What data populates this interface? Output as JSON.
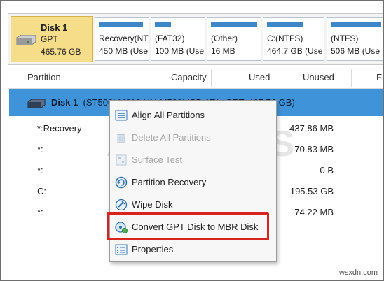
{
  "disk_map": {
    "disk": {
      "name": "Disk 1",
      "style": "GPT",
      "size": "465.76 GB"
    },
    "partitions": [
      {
        "name": "Recovery(NT",
        "size": "450 MB (Use"
      },
      {
        "name": "(FAT32)",
        "size": "100 MB (Use"
      },
      {
        "name": "(Other)",
        "size": "16 MB"
      },
      {
        "name": "C:(NTFS)",
        "size": "464.7 GB (Use"
      },
      {
        "name": "(NTFS)",
        "size": "506 MB (Use"
      }
    ]
  },
  "table": {
    "headers": {
      "partition": "Partition",
      "capacity": "Capacity",
      "used": "Used",
      "unused": "Unused",
      "fs": "F"
    },
    "disk_row": {
      "name": "Disk 1",
      "detail": "(ST500LM012 HN-M500MBB ATA, GPT, 465.76 GB)"
    },
    "rows": [
      {
        "partition": "*:Recovery",
        "unused": "437.86 MB"
      },
      {
        "partition": "*:",
        "unused": "70.83 MB"
      },
      {
        "partition": "*:",
        "unused": "0 B"
      },
      {
        "partition": "C:",
        "unused": "195.53 GB"
      },
      {
        "partition": "*:",
        "unused": "74.22 MB"
      }
    ]
  },
  "context_menu": {
    "items": [
      {
        "label": "Align All Partitions",
        "icon": "align-partitions-icon",
        "enabled": true
      },
      {
        "label": "Delete All Partitions",
        "icon": "trash-icon",
        "enabled": false
      },
      {
        "label": "Surface Test",
        "icon": "surface-test-icon",
        "enabled": false
      },
      {
        "label": "Partition Recovery",
        "icon": "partition-recovery-icon",
        "enabled": true
      },
      {
        "label": "Wipe Disk",
        "icon": "wipe-disk-icon",
        "enabled": true
      },
      {
        "label": "Convert GPT Disk to MBR Disk",
        "icon": "convert-disk-icon",
        "enabled": true,
        "highlighted": true
      },
      {
        "label": "Properties",
        "icon": "properties-icon",
        "enabled": true
      }
    ]
  },
  "watermark": {
    "text": "APPUALS",
    "site": "wsxdn.com"
  },
  "colors": {
    "selection": "#3f93d8",
    "disk_tile": "#f6dd8a",
    "partition_bar": "#3d86c8",
    "highlight_box": "#d9231f"
  }
}
